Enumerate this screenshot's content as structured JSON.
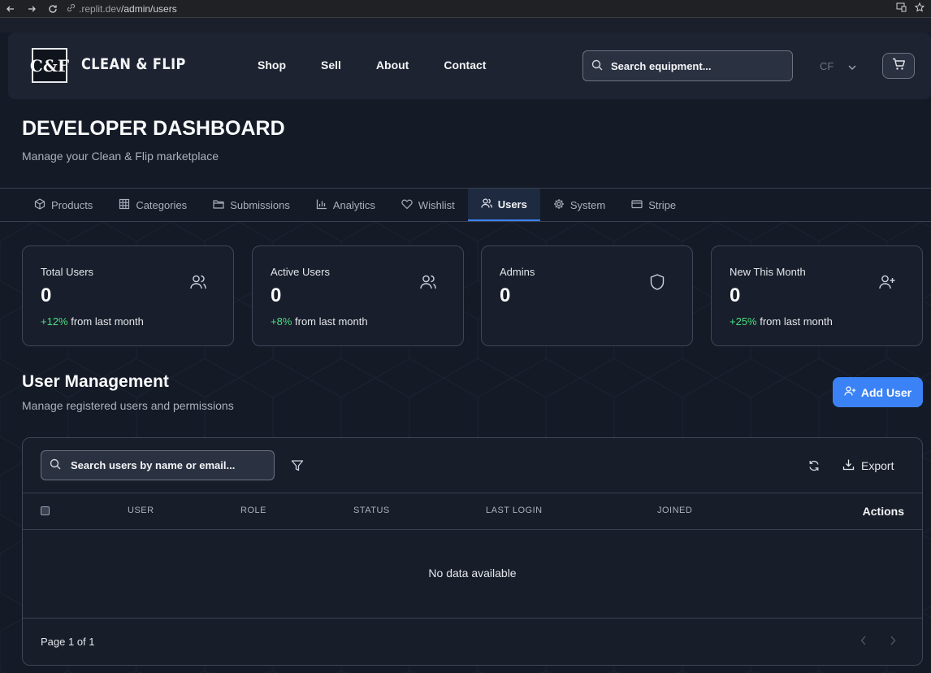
{
  "browser": {
    "url_prefix": ".replit.dev",
    "url_path": "/admin/users"
  },
  "header": {
    "logo": "C&F",
    "brand": "CLEAN & FLIP",
    "nav": [
      {
        "label": "Shop"
      },
      {
        "label": "Sell"
      },
      {
        "label": "About"
      },
      {
        "label": "Contact"
      }
    ],
    "search_placeholder": "Search equipment...",
    "user_initials": "CF"
  },
  "page": {
    "title": "DEVELOPER DASHBOARD",
    "subtitle": "Manage your Clean & Flip marketplace"
  },
  "tabs": [
    {
      "label": "Products",
      "icon": "box-icon"
    },
    {
      "label": "Categories",
      "icon": "grid-icon"
    },
    {
      "label": "Submissions",
      "icon": "folder-icon"
    },
    {
      "label": "Analytics",
      "icon": "bar-chart-icon"
    },
    {
      "label": "Wishlist",
      "icon": "heart-icon"
    },
    {
      "label": "Users",
      "icon": "users-icon",
      "active": true
    },
    {
      "label": "System",
      "icon": "gear-icon"
    },
    {
      "label": "Stripe",
      "icon": "credit-card-icon"
    }
  ],
  "stats": [
    {
      "label": "Total Users",
      "value": "0",
      "pct": "+12%",
      "suffix": " from last month",
      "icon": "users-icon"
    },
    {
      "label": "Active Users",
      "value": "0",
      "pct": "+8%",
      "suffix": " from last month",
      "icon": "users-icon"
    },
    {
      "label": "Admins",
      "value": "0",
      "pct": "",
      "suffix": "",
      "icon": "shield-icon"
    },
    {
      "label": "New This Month",
      "value": "0",
      "pct": "+25%",
      "suffix": " from last month",
      "icon": "user-plus-icon"
    }
  ],
  "user_management": {
    "title": "User Management",
    "subtitle": "Manage registered users and permissions",
    "add_label": "Add User",
    "search_placeholder": "Search users by name or email...",
    "export_label": "Export",
    "columns": [
      "USER",
      "ROLE",
      "STATUS",
      "LAST LOGIN",
      "JOINED"
    ],
    "actions_label": "Actions",
    "empty": "No data available",
    "page_info": "Page 1 of 1"
  },
  "colors": {
    "accent": "#3b82f6",
    "positive": "#4ade80",
    "background": "#141a26"
  }
}
